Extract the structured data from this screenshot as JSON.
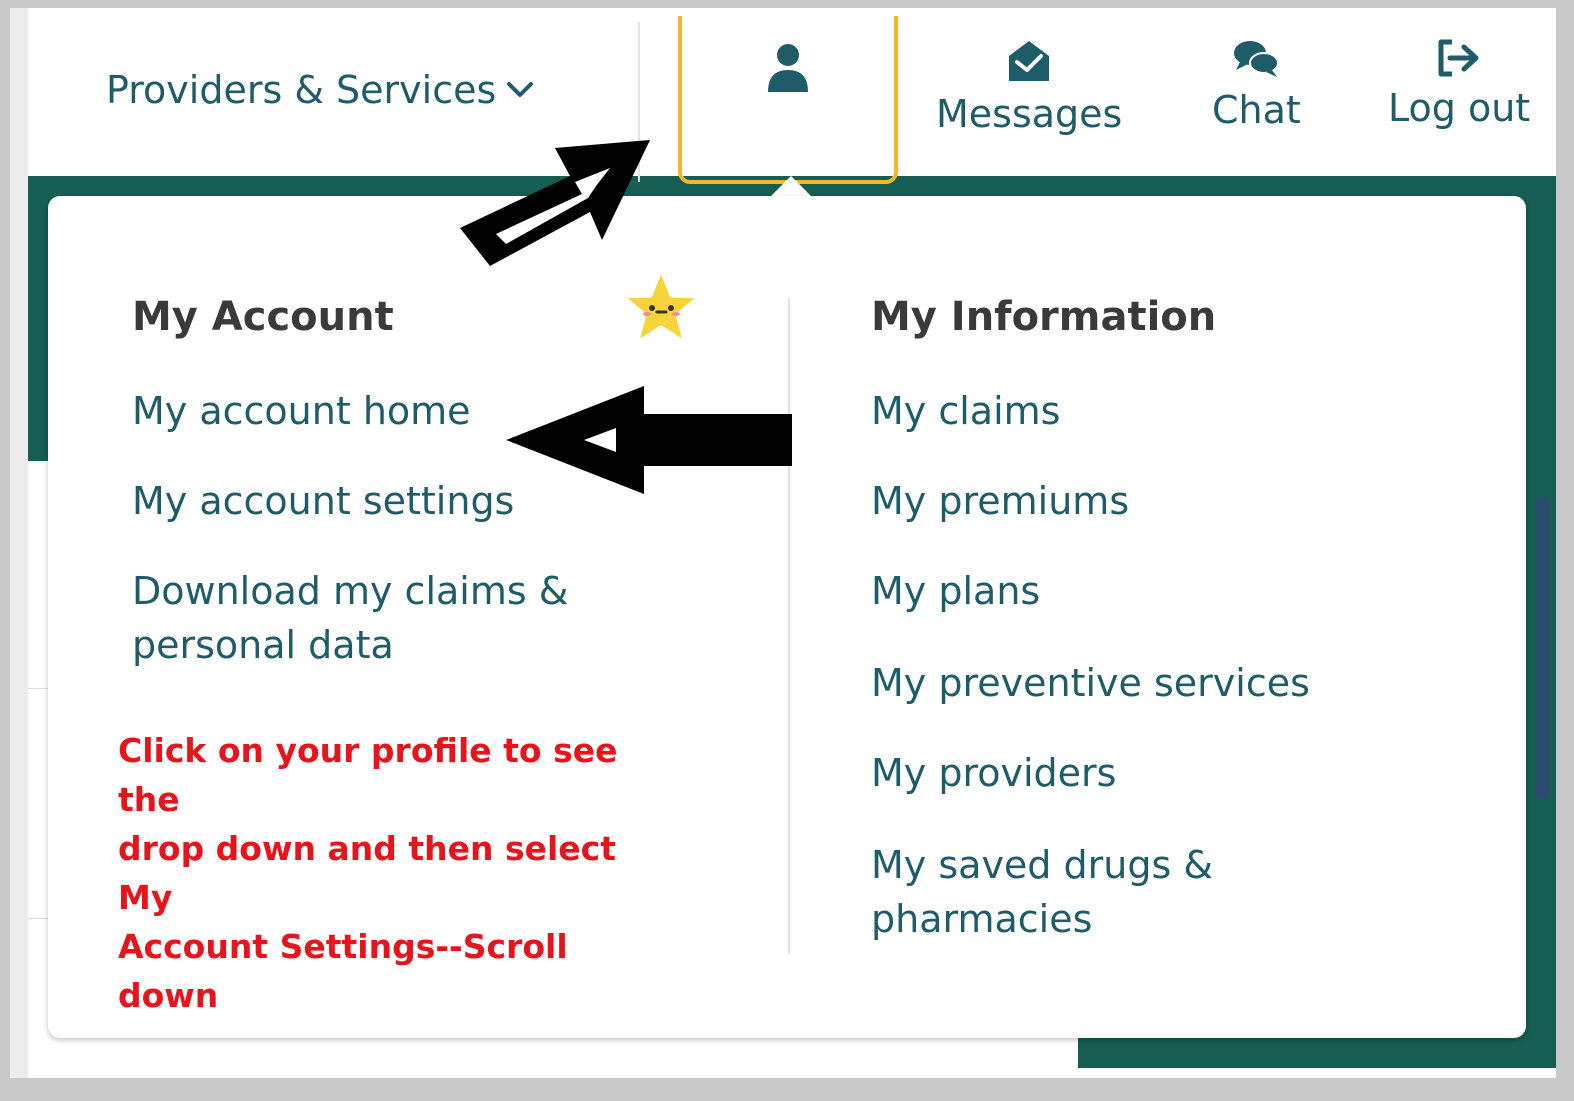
{
  "nav": {
    "providers_label": "Providers & Services",
    "messages_label": "Messages",
    "chat_label": "Chat",
    "logout_label": "Log out"
  },
  "account_menu": {
    "heading": "My Account",
    "items": [
      {
        "label": "My account home"
      },
      {
        "label": "My account settings"
      },
      {
        "label_line1": "Download my claims &",
        "label_line2": "personal data"
      }
    ]
  },
  "information_menu": {
    "heading": "My Information",
    "items": [
      {
        "label": "My claims"
      },
      {
        "label": "My premiums"
      },
      {
        "label": "My plans"
      },
      {
        "label": "My preventive services"
      },
      {
        "label": "My providers"
      },
      {
        "label_line1": "My saved drugs &",
        "label_line2": "pharmacies"
      }
    ]
  },
  "annotation": {
    "line1": "Click on your profile to see the",
    "line2": "drop down and then select My",
    "line3": "Account Settings--Scroll down"
  },
  "colors": {
    "teal": "#165e53",
    "link": "#1f5c6a",
    "highlight": "#f1b82d",
    "annotation": "#e8141c",
    "star": "#f8d33a"
  },
  "icons": [
    "chevron-down-icon",
    "user-icon",
    "envelope-open-icon",
    "chat-bubbles-icon",
    "sign-out-icon",
    "star-icon",
    "arrow-icon"
  ]
}
